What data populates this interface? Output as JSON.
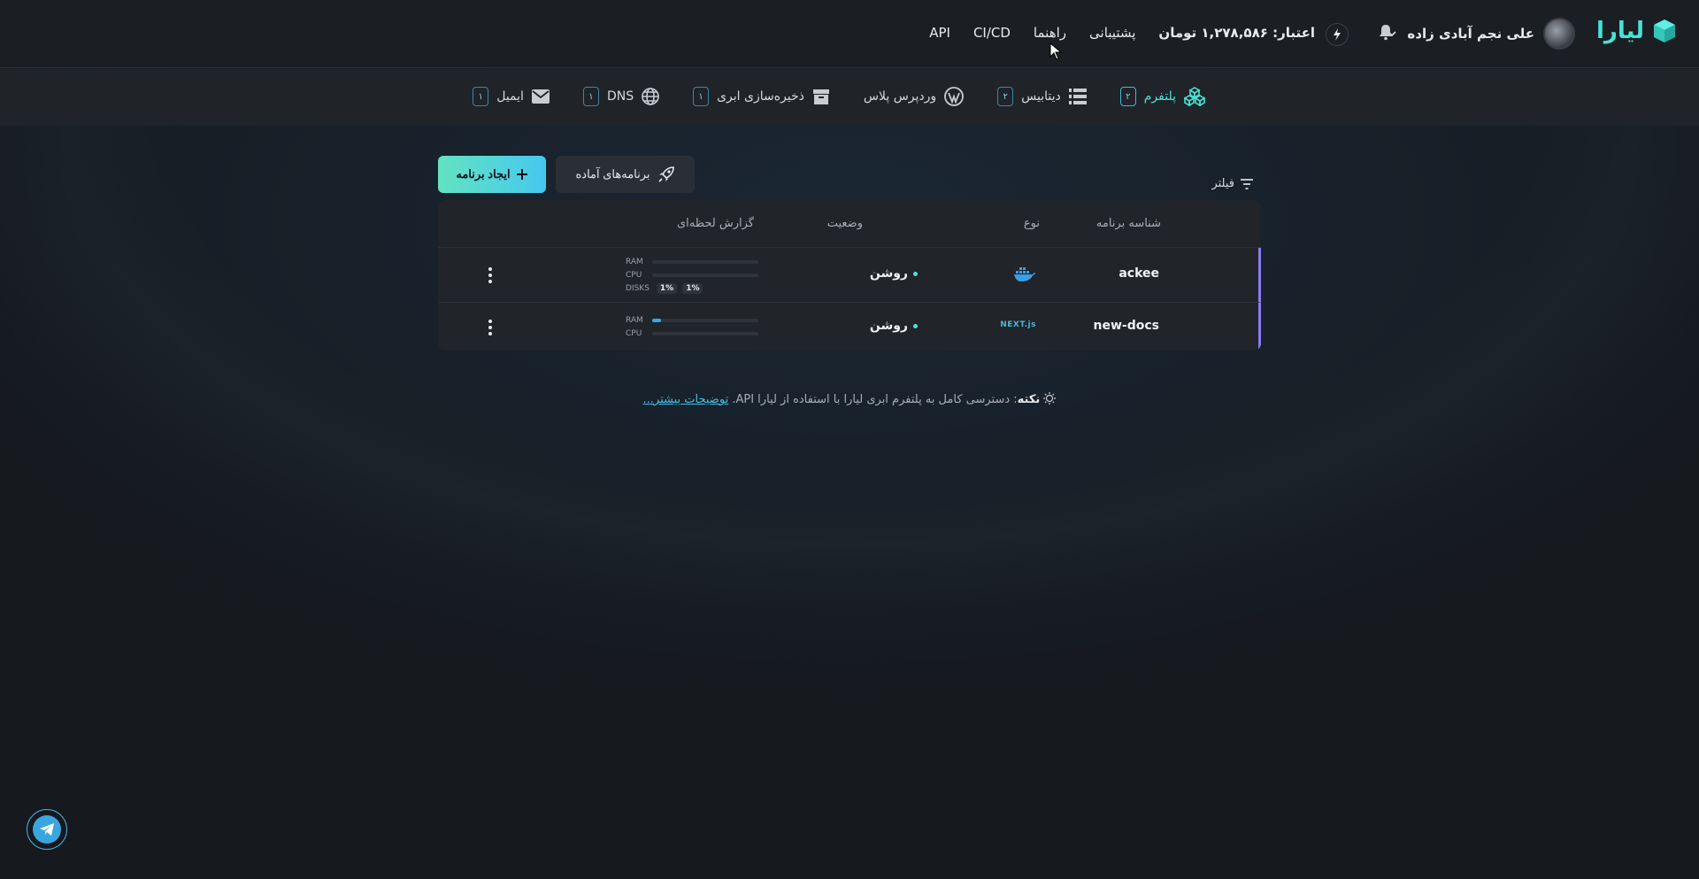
{
  "header": {
    "brand": "لیارا",
    "user_name": "علی نجم آبادی زاده",
    "credit": "اعتبار: ۱,۲۷۸,۵۸۶ تومان",
    "nav": [
      "پشتیبانی",
      "راهنما",
      "CI/CD",
      "API"
    ]
  },
  "services": [
    {
      "label": "پلتفرم",
      "count": "۲",
      "icon": "platform-icon",
      "active": true
    },
    {
      "label": "دیتابیس",
      "count": "۲",
      "icon": "database-icon"
    },
    {
      "label": "وردپرس پلاس",
      "count": "",
      "icon": "wordpress-icon"
    },
    {
      "label": "ذخیره‌سازی ابری",
      "count": "۱",
      "icon": "archive-icon"
    },
    {
      "label": "DNS",
      "count": "۱",
      "icon": "globe-icon"
    },
    {
      "label": "ایمیل",
      "count": "۱",
      "icon": "mail-icon"
    }
  ],
  "toolbar": {
    "create_label": "ایجاد برنامه",
    "ready_label": "برنامه‌های آماده",
    "filter_label": "فیلتر"
  },
  "table": {
    "headers": {
      "name": "شناسه برنامه",
      "type": "نوع",
      "status": "وضعیت",
      "report": "گزارش لحظه‌ای"
    },
    "rows": [
      {
        "name": "ackee",
        "type_icon": "docker-icon",
        "status": "روشن",
        "metrics": {
          "ram_label": "RAM",
          "ram_fill": 0,
          "cpu_label": "CPU",
          "cpu_fill": 0,
          "disks_label": "DISKS",
          "disk1": "1%",
          "disk2": "1%"
        }
      },
      {
        "name": "new-docs",
        "type_icon": "nextjs-icon",
        "type_text": "NEXT.js",
        "status": "روشن",
        "metrics": {
          "ram_label": "RAM",
          "ram_fill": 0.08,
          "cpu_label": "CPU",
          "cpu_fill": 0
        }
      }
    ]
  },
  "tip": {
    "bold": "نکته",
    "text": ": دسترسی کامل به پلتفرم ابری لیارا با استفاده از لیارا API.",
    "link": "توضیحات بیشتر..."
  },
  "colors": {
    "accent": "#47e3d6",
    "row_marker": "#8d7bf0",
    "bar": "#3aa8e8"
  }
}
